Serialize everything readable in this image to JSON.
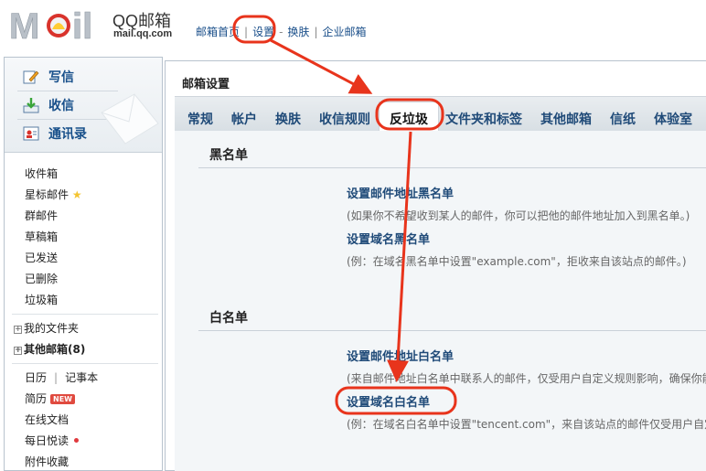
{
  "brand": {
    "logo_text": "Mail",
    "title": "QQ邮箱",
    "url": "mail.qq.com"
  },
  "topnav": {
    "items": [
      "邮箱首页",
      "设置",
      "换肤",
      "企业邮箱"
    ],
    "separators": [
      "|",
      "-",
      "|"
    ]
  },
  "sidebar": {
    "quick": [
      {
        "label": "写信",
        "icon": "compose-icon"
      },
      {
        "label": "收信",
        "icon": "inbox-download-icon"
      },
      {
        "label": "通讯录",
        "icon": "contacts-icon"
      }
    ],
    "folders": [
      "收件箱",
      "星标邮件",
      "群邮件",
      "草稿箱",
      "已发送",
      "已删除",
      "垃圾箱"
    ],
    "my_folders": "我的文件夹",
    "other_mailboxes": "其他邮箱(8)",
    "tools": {
      "calendar": "日历",
      "sep": "|",
      "notes": "记事本",
      "jianli": "简历",
      "new_badge": "NEW",
      "online_docs": "在线文档",
      "daily_read": "每日悦读",
      "attachments": "附件收藏"
    }
  },
  "main": {
    "title": "邮箱设置",
    "tabs": [
      "常规",
      "帐户",
      "换肤",
      "收信规则",
      "反垃圾",
      "文件夹和标签",
      "其他邮箱",
      "信纸",
      "体验室"
    ],
    "active_tab": "反垃圾",
    "blacklist": {
      "title": "黑名单",
      "addr_link": "设置邮件地址黑名单",
      "addr_desc": "(如果你不希望收到某人的邮件，你可以把他的邮件地址加入到黑名单。)",
      "domain_link": "设置域名黑名单",
      "domain_desc": "(例：在域名黑名单中设置\"example.com\"，拒收来自该站点的邮件。)"
    },
    "whitelist": {
      "title": "白名单",
      "addr_link": "设置邮件地址白名单",
      "addr_desc": "(来自邮件地址白名单中联系人的邮件，仅受用户自定义规则影响，确保你能",
      "domain_link": "设置域名白名单",
      "domain_desc": "(例：在域名白名单中设置\"tencent.com\"，来自该站点的邮件仅受用户自定"
    }
  },
  "colors": {
    "annotation": "#e8341c",
    "link": "#1f4a78",
    "tabbar": "#dde3e8"
  }
}
